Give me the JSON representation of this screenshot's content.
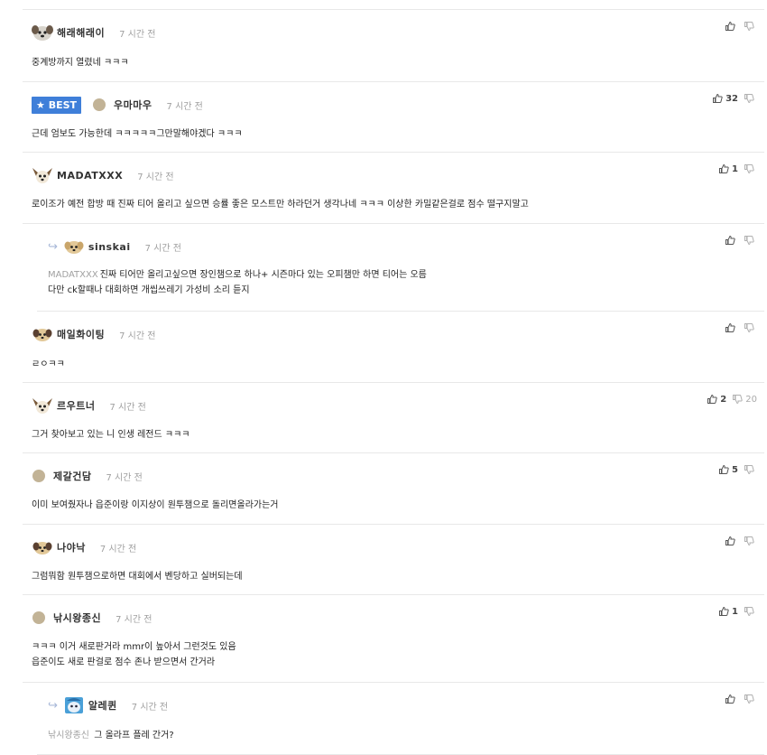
{
  "comments": [
    {
      "nick": "해래해래이",
      "time": "7 시간 전",
      "body": [
        "중계방까지 열렸네 ㅋㅋㅋ"
      ],
      "up": "",
      "down": ""
    },
    {
      "best_label": "BEST",
      "nick": "우마마우",
      "time": "7 시간 전",
      "body": [
        "근데 엄보도 가능한데 ㅋㅋㅋㅋㅋ그만말해야겠다 ㅋㅋㅋ"
      ],
      "up": "32",
      "down": ""
    },
    {
      "nick": "MADATXXX",
      "time": "7 시간 전",
      "body": [
        "로이조가 예전 합방 때 진짜 티어 올리고 싶으면 승률 좋은 모스트만 하라던거 생각나네 ㅋㅋㅋ 이상한 카밀같은걸로 점수 떨구지말고"
      ],
      "up": "1",
      "down": ""
    },
    {
      "nick": "sinskai",
      "time": "7 시간 전",
      "mention": "MADATXXX",
      "body": [
        "진짜 티어만 올리고싶으면 장인챔으로 하나+ 시즌마다 있는 오피챔만 하면 티어는 오름",
        "다만 ck할때나 대회하면 개씹쓰레기 가성비 소리 듣지"
      ],
      "up": "",
      "down": ""
    },
    {
      "nick": "매일화이팅",
      "time": "7 시간 전",
      "body": [
        "ㄹㅇㅋㅋ"
      ],
      "up": "",
      "down": ""
    },
    {
      "nick": "르우트너",
      "time": "7 시간 전",
      "body": [
        "그거 찾아보고 있는 니 인생 레전드 ㅋㅋㅋ"
      ],
      "up": "2",
      "down": "20"
    },
    {
      "nick": "제갈건담",
      "time": "7 시간 전",
      "body": [
        "이미 보여줬자나 읍준이랑 이지상이 원투챔으로 돌리면올라가는거"
      ],
      "up": "5",
      "down": ""
    },
    {
      "nick": "나야낙",
      "time": "7 시간 전",
      "body": [
        "그럼뭐함 원투챔으로하면 대회에서 벤당하고 실버되는데"
      ],
      "up": "",
      "down": ""
    },
    {
      "nick": "낚시왕종신",
      "time": "7 시간 전",
      "body": [
        "ㅋㅋㅋ 이거 새로판거라 mmr이 높아서 그런것도 있음",
        "읍준이도 새로 판걸로 점수 존나 받으면서 간거라"
      ],
      "up": "1",
      "down": ""
    },
    {
      "nick": "알레퀸",
      "time": "7 시간 전",
      "mention": "낚시왕종신",
      "body": [
        "그 올라프 플레 간거?"
      ],
      "up": "",
      "down": ""
    }
  ],
  "colors": {
    "accent": "#3f7fd9",
    "time": "#a0a0a0",
    "divider": "#e8e8e8"
  }
}
